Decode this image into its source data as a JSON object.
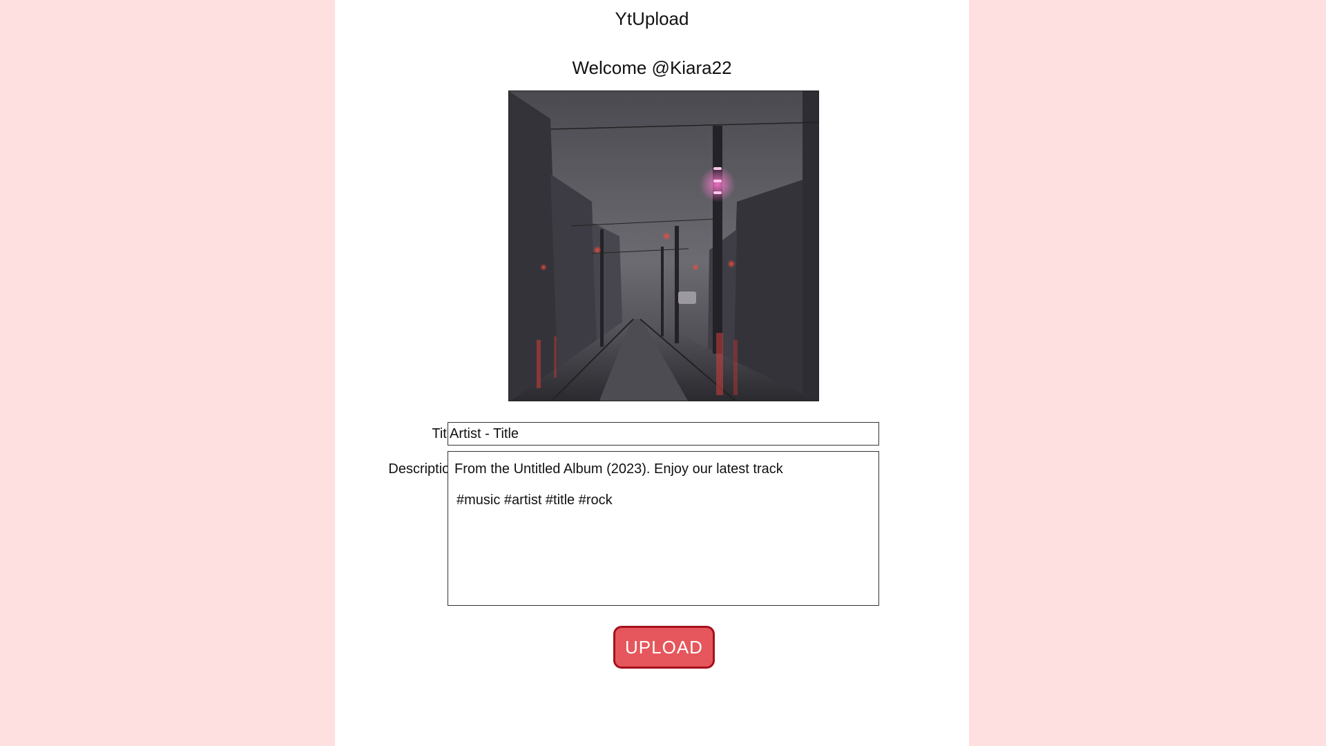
{
  "app": {
    "title": "YtUpload",
    "welcome": "Welcome @Kiara22"
  },
  "cover_image": {
    "description_icon": "album-cover-image"
  },
  "form": {
    "title_label": "Title:",
    "title_value": "Artist - Title",
    "description_label": "Description:",
    "description_line1": "From the Untitled Album (2023). Enjoy our latest track",
    "description_line2": "#music #artist #title #rock"
  },
  "actions": {
    "upload_label": "UPLOAD"
  },
  "colors": {
    "page_background": "#ffe0e1",
    "panel_background": "#ffffff",
    "button_fill": "#e5575c",
    "button_border": "#a5101c"
  }
}
